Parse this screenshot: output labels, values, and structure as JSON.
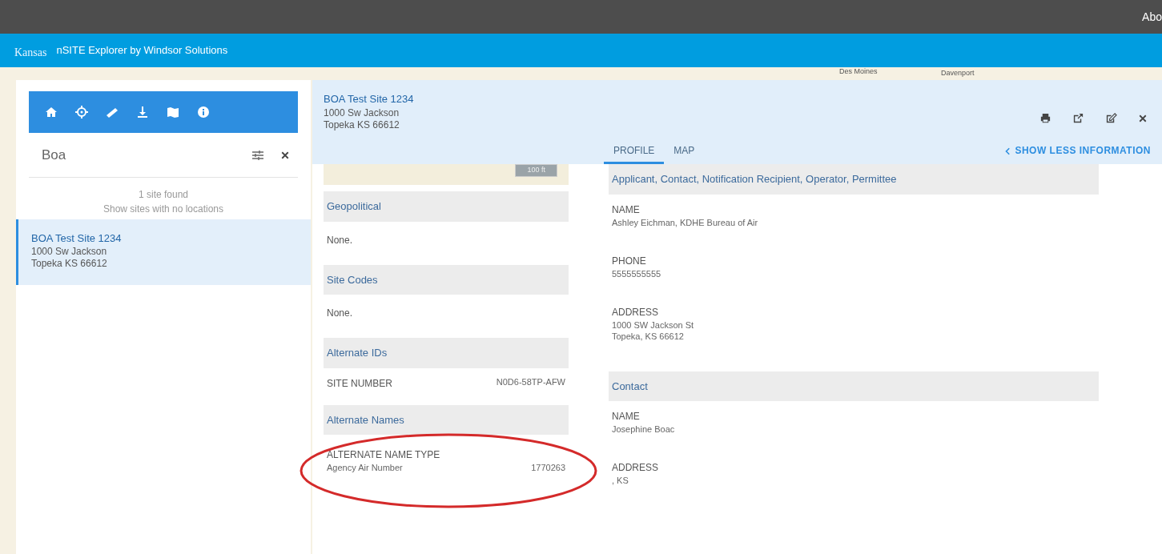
{
  "top_bar": {
    "link": "Abo"
  },
  "header": {
    "logo_text": "Kansas",
    "title": "nSITE Explorer by Windsor Solutions"
  },
  "map": {
    "labels": [
      "Des Moines",
      "Davenport"
    ],
    "scale": "100 ft"
  },
  "sidebar": {
    "search": {
      "value": "Boa"
    },
    "result_count": "1 site found",
    "no_location_link": "Show sites with no locations",
    "results": [
      {
        "name": "BOA Test Site 1234",
        "address_lines": [
          "1000 Sw Jackson",
          "Topeka KS 66612"
        ],
        "selected": true
      }
    ]
  },
  "detail": {
    "title": "BOA Test Site 1234",
    "address_lines": [
      "1000 Sw Jackson",
      "Topeka KS 66612"
    ],
    "tabs": [
      {
        "label": "PROFILE",
        "selected": true
      },
      {
        "label": "MAP",
        "selected": false
      }
    ],
    "show_less": "SHOW LESS INFORMATION",
    "left_sections": [
      {
        "heading": "Geopolitical",
        "kind": "text",
        "text": "None."
      },
      {
        "heading": "Site Codes",
        "kind": "text",
        "text": "None."
      },
      {
        "heading": "Alternate IDs",
        "kind": "pairs",
        "rows": [
          {
            "label": "SITE NUMBER",
            "value": "N0D6-58TP-AFW"
          }
        ]
      },
      {
        "heading": "Alternate Names",
        "kind": "typed",
        "label": "ALTERNATE NAME TYPE",
        "rows": [
          {
            "label": "Agency Air Number",
            "value": "1770263"
          }
        ]
      }
    ],
    "right_sections": [
      {
        "heading": "Applicant, Contact, Notification Recipient, Operator, Permittee",
        "fields": [
          {
            "label": "NAME",
            "value_lines": [
              "Ashley Eichman, KDHE Bureau of Air"
            ]
          },
          {
            "label": "PHONE",
            "value_lines": [
              "5555555555"
            ]
          },
          {
            "label": "ADDRESS",
            "value_lines": [
              "1000 SW Jackson St",
              "Topeka, KS 66612"
            ]
          }
        ]
      },
      {
        "heading": "Contact",
        "fields": [
          {
            "label": "NAME",
            "value_lines": [
              "Josephine Boac"
            ]
          },
          {
            "label": "ADDRESS",
            "value_lines": [
              ", KS"
            ]
          }
        ]
      }
    ]
  },
  "annotation": {
    "color": "#d42a2a"
  }
}
